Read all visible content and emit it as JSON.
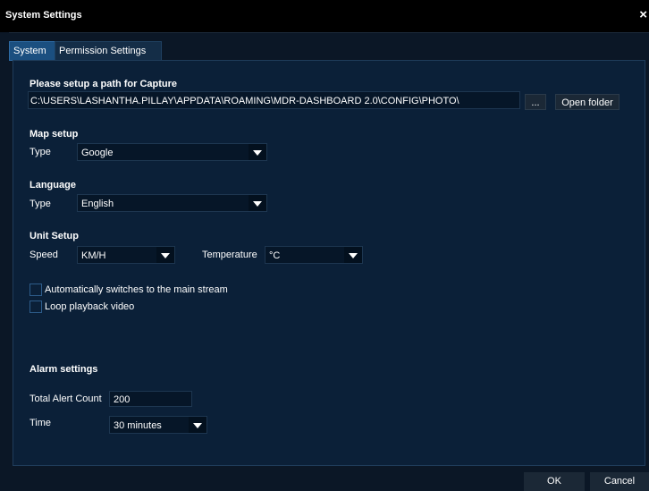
{
  "window": {
    "title": "System Settings",
    "close_glyph": "×"
  },
  "tabs": [
    {
      "label": "System",
      "active": true
    },
    {
      "label": "Permission Settings",
      "active": false
    }
  ],
  "capture": {
    "heading": "Please setup a path for Capture",
    "path_value": "C:\\USERS\\LASHANTHA.PILLAY\\APPDATA\\ROAMING\\MDR-DASHBOARD 2.0\\CONFIG\\PHOTO\\",
    "browse_label": "...",
    "open_folder_label": "Open folder"
  },
  "map_setup": {
    "heading": "Map setup",
    "type_label": "Type",
    "type_value": "Google"
  },
  "language": {
    "heading": "Language",
    "type_label": "Type",
    "type_value": "English"
  },
  "unit_setup": {
    "heading": "Unit Setup",
    "speed_label": "Speed",
    "speed_value": "KM/H",
    "temperature_label": "Temperature",
    "temperature_value": "°C"
  },
  "options": [
    {
      "label": "Automatically switches to the main stream",
      "checked": false
    },
    {
      "label": "Loop playback video",
      "checked": false
    }
  ],
  "alarm": {
    "heading": "Alarm settings",
    "count_label": "Total Alert Count",
    "count_value": "200",
    "time_label": "Time",
    "time_value": "30 minutes"
  },
  "footer": {
    "ok_label": "OK",
    "cancel_label": "Cancel"
  },
  "colors": {
    "background": "#0b1726",
    "panel": "#0b2038",
    "tab_active": "#1b4f80",
    "titlebar": "#000000"
  }
}
